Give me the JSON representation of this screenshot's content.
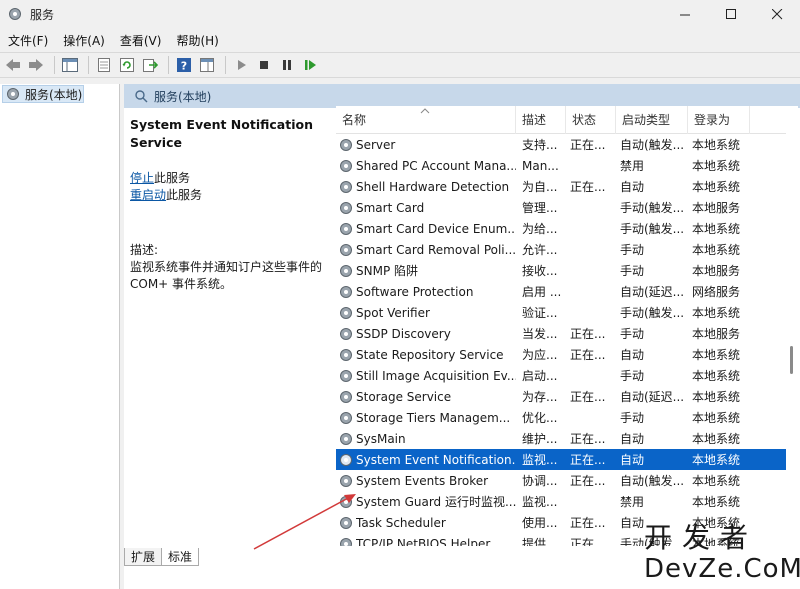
{
  "window": {
    "title": "服务"
  },
  "menu": [
    "文件(F)",
    "操作(A)",
    "查看(V)",
    "帮助(H)"
  ],
  "tree": {
    "item": "服务(本地)"
  },
  "panel": {
    "header": "服务(本地)",
    "service_title": "System Event Notification Service",
    "stop_link": "停止",
    "stop_suffix": "此服务",
    "restart_link": "重启动",
    "restart_suffix": "此服务",
    "desc_label": "描述:",
    "desc_text": "监视系统事件并通知订户这些事件的 COM+ 事件系统。"
  },
  "columns": [
    "名称",
    "描述",
    "状态",
    "启动类型",
    "登录为"
  ],
  "rows": [
    {
      "name": "Server",
      "desc": "支持...",
      "status": "正在...",
      "type": "自动(触发...",
      "logon": "本地系统"
    },
    {
      "name": "Shared PC Account Mana...",
      "desc": "Man...",
      "status": "",
      "type": "禁用",
      "logon": "本地系统"
    },
    {
      "name": "Shell Hardware Detection",
      "desc": "为自...",
      "status": "正在...",
      "type": "自动",
      "logon": "本地系统"
    },
    {
      "name": "Smart Card",
      "desc": "管理...",
      "status": "",
      "type": "手动(触发...",
      "logon": "本地服务"
    },
    {
      "name": "Smart Card Device Enum...",
      "desc": "为给...",
      "status": "",
      "type": "手动(触发...",
      "logon": "本地系统"
    },
    {
      "name": "Smart Card Removal Poli...",
      "desc": "允许...",
      "status": "",
      "type": "手动",
      "logon": "本地系统"
    },
    {
      "name": "SNMP 陷阱",
      "desc": "接收...",
      "status": "",
      "type": "手动",
      "logon": "本地服务"
    },
    {
      "name": "Software Protection",
      "desc": "启用 ...",
      "status": "",
      "type": "自动(延迟...",
      "logon": "网络服务"
    },
    {
      "name": "Spot Verifier",
      "desc": "验证...",
      "status": "",
      "type": "手动(触发...",
      "logon": "本地系统"
    },
    {
      "name": "SSDP Discovery",
      "desc": "当发...",
      "status": "正在...",
      "type": "手动",
      "logon": "本地服务"
    },
    {
      "name": "State Repository Service",
      "desc": "为应...",
      "status": "正在...",
      "type": "自动",
      "logon": "本地系统"
    },
    {
      "name": "Still Image Acquisition Ev...",
      "desc": "启动...",
      "status": "",
      "type": "手动",
      "logon": "本地系统"
    },
    {
      "name": "Storage Service",
      "desc": "为存...",
      "status": "正在...",
      "type": "自动(延迟...",
      "logon": "本地系统"
    },
    {
      "name": "Storage Tiers Managem...",
      "desc": "优化...",
      "status": "",
      "type": "手动",
      "logon": "本地系统"
    },
    {
      "name": "SysMain",
      "desc": "维护...",
      "status": "正在...",
      "type": "自动",
      "logon": "本地系统"
    },
    {
      "name": "System Event Notification...",
      "desc": "监视...",
      "status": "正在...",
      "type": "自动",
      "logon": "本地系统"
    },
    {
      "name": "System Events Broker",
      "desc": "协调...",
      "status": "正在...",
      "type": "自动(触发...",
      "logon": "本地系统"
    },
    {
      "name": "System Guard 运行时监视...",
      "desc": "监视...",
      "status": "",
      "type": "禁用",
      "logon": "本地系统"
    },
    {
      "name": "Task Scheduler",
      "desc": "使用...",
      "status": "正在...",
      "type": "自动",
      "logon": "本地系统"
    },
    {
      "name": "TCP/IP NetBIOS Helper",
      "desc": "提供...",
      "status": "正在...",
      "type": "手动(触发...",
      "logon": "本地系统"
    }
  ],
  "selected_index": 15,
  "tabs": [
    "扩展",
    "标准"
  ],
  "watermark": {
    "top": "开发者",
    "bottom": "DevZe.CoM"
  },
  "colors": {
    "selection": "#0a64c8",
    "header_band": "#c7d8ea",
    "link": "#0b57a4",
    "annotation_arrow": "#d23a3a"
  }
}
